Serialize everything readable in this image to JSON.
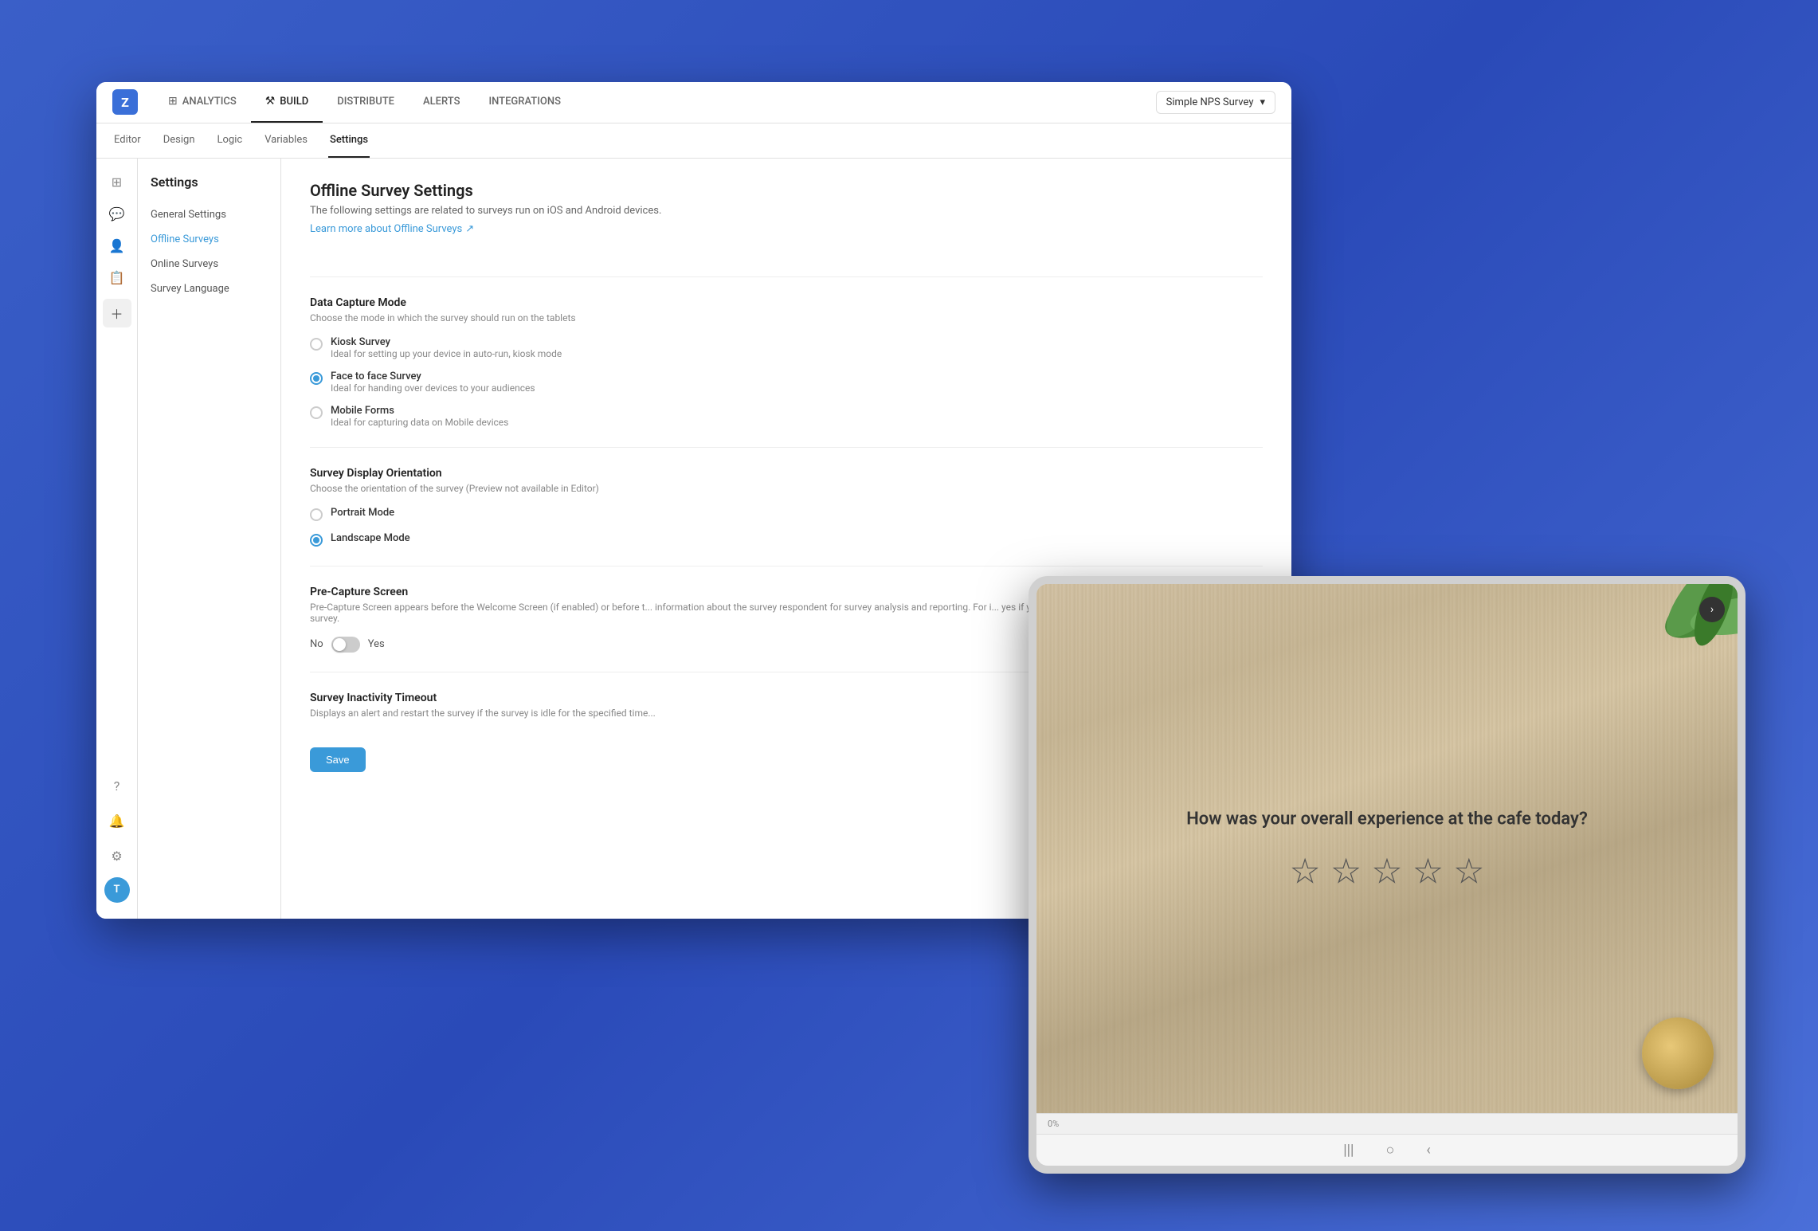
{
  "app": {
    "logo_letter": "Z",
    "survey_name": "Simple NPS Survey",
    "nav_tabs": [
      {
        "label": "ANALYTICS",
        "icon": "📊",
        "active": false
      },
      {
        "label": "BUILD",
        "icon": "🔧",
        "active": true
      },
      {
        "label": "DISTRIBUTE",
        "icon": "",
        "active": false
      },
      {
        "label": "ALERTS",
        "icon": "",
        "active": false
      },
      {
        "label": "INTEGRATIONS",
        "icon": "",
        "active": false
      }
    ]
  },
  "second_nav": {
    "items": [
      "Editor",
      "Design",
      "Logic",
      "Variables",
      "Settings"
    ]
  },
  "sidebar": {
    "title": "Settings",
    "items": [
      {
        "label": "General Settings",
        "active": false
      },
      {
        "label": "Offline Surveys",
        "active": true
      },
      {
        "label": "Online Surveys",
        "active": false
      },
      {
        "label": "Survey Language",
        "active": false
      }
    ]
  },
  "settings_page": {
    "title": "Offline Survey Settings",
    "description": "The following settings are related to surveys run on iOS and Android devices.",
    "learn_more_text": "Learn more about Offline Surveys",
    "learn_more_icon": "↗",
    "sections": [
      {
        "title": "Data Capture Mode",
        "subtitle": "Choose the mode in which the survey should run on the tablets",
        "type": "radio",
        "options": [
          {
            "label": "Kiosk Survey",
            "description": "Ideal for setting up your device in auto-run, kiosk mode",
            "selected": false
          },
          {
            "label": "Face to face Survey",
            "description": "Ideal for handing over devices to your audiences",
            "selected": true
          },
          {
            "label": "Mobile Forms",
            "description": "Ideal for capturing data on Mobile devices",
            "selected": false
          }
        ]
      },
      {
        "title": "Survey Display Orientation",
        "subtitle": "Choose the orientation of the survey (Preview not available in Editor)",
        "type": "radio",
        "options": [
          {
            "label": "Portrait Mode",
            "description": "",
            "selected": false
          },
          {
            "label": "Landscape Mode",
            "description": "",
            "selected": true
          }
        ]
      },
      {
        "title": "Pre-Capture Screen",
        "subtitle": "Pre-Capture Screen appears before the Welcome Screen (if enabled) or before t... information about the survey respondent for survey analysis and reporting. For i... yes if you'd like to display the Pre-Capture Screen in the survey.",
        "type": "toggle",
        "toggle_no": "No",
        "toggle_yes": "Yes",
        "toggle_on": false
      },
      {
        "title": "Survey Inactivity Timeout",
        "subtitle": "Displays an alert and restart the survey if the survey is idle for the specified time...",
        "type": "info"
      }
    ],
    "save_button": "Save"
  },
  "tablet": {
    "question": "How was your overall experience at the cafe today?",
    "stars_count": 5,
    "progress_text": "0%",
    "next_icon": "›"
  }
}
